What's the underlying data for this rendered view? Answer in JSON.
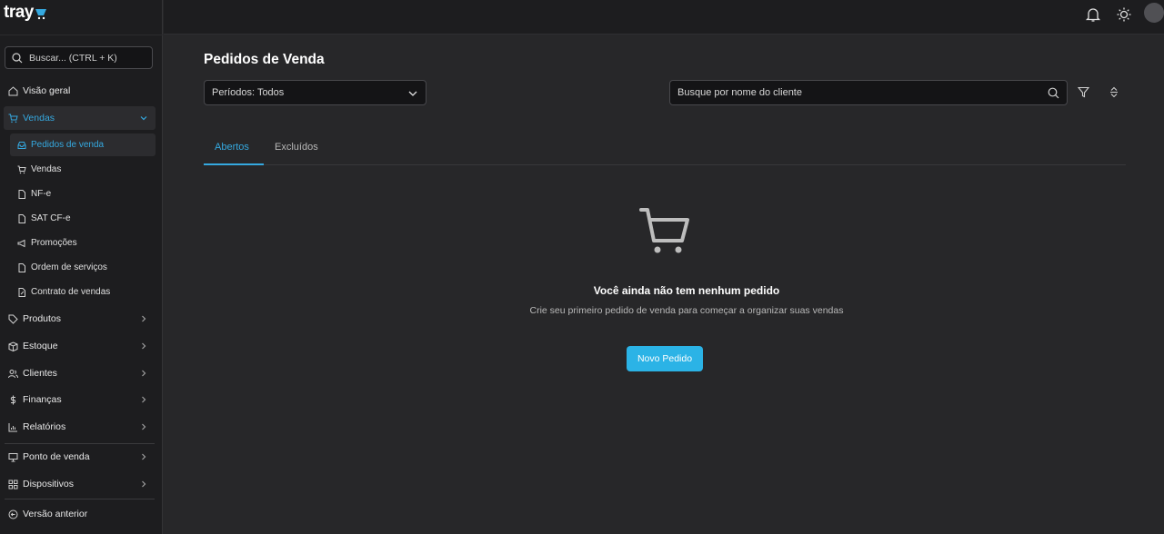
{
  "app": {
    "logo_text": "tray"
  },
  "sidebar": {
    "search_placeholder": "Buscar... (CTRL + K)",
    "items": [
      {
        "label": "Visão geral",
        "icon": "home-icon"
      },
      {
        "label": "Vendas",
        "icon": "cart-icon",
        "expanded": true
      },
      {
        "label": "Produtos",
        "icon": "tag-icon"
      },
      {
        "label": "Estoque",
        "icon": "box-icon"
      },
      {
        "label": "Clientes",
        "icon": "users-icon"
      },
      {
        "label": "Finanças",
        "icon": "dollar-icon"
      },
      {
        "label": "Relatórios",
        "icon": "chart-icon"
      },
      {
        "label": "Ponto de venda",
        "icon": "monitor-icon"
      },
      {
        "label": "Dispositivos",
        "icon": "grid-icon"
      },
      {
        "label": "Versão anterior",
        "icon": "back-circle-icon"
      }
    ],
    "vendas_sub": [
      {
        "label": "Pedidos de venda",
        "icon": "inbox-icon",
        "current": true
      },
      {
        "label": "Vendas",
        "icon": "cart-icon"
      },
      {
        "label": "NF-e",
        "icon": "file-icon"
      },
      {
        "label": "SAT CF-e",
        "icon": "file-icon"
      },
      {
        "label": "Promoções",
        "icon": "megaphone-icon"
      },
      {
        "label": "Ordem de serviços",
        "icon": "file-icon"
      },
      {
        "label": "Contrato de vendas",
        "icon": "file-edit-icon"
      }
    ]
  },
  "header": {
    "icons": [
      "bell-icon",
      "sun-icon",
      "avatar"
    ]
  },
  "main": {
    "title": "Pedidos de Venda",
    "period_select": "Períodos: Todos",
    "client_search_placeholder": "Busque por nome do cliente",
    "tabs": [
      {
        "label": "Abertos",
        "active": true
      },
      {
        "label": "Excluídos",
        "active": false
      }
    ],
    "empty_state": {
      "icon": "cart-icon",
      "title": "Você ainda não tem nenhum pedido",
      "description": "Crie seu primeiro pedido de venda para começar a organizar suas vendas",
      "button": "Novo Pedido"
    }
  },
  "colors": {
    "accent": "#35a9e0",
    "button": "#2bb3e6",
    "background": "#272729",
    "sidebar": "#1d1d1f"
  }
}
